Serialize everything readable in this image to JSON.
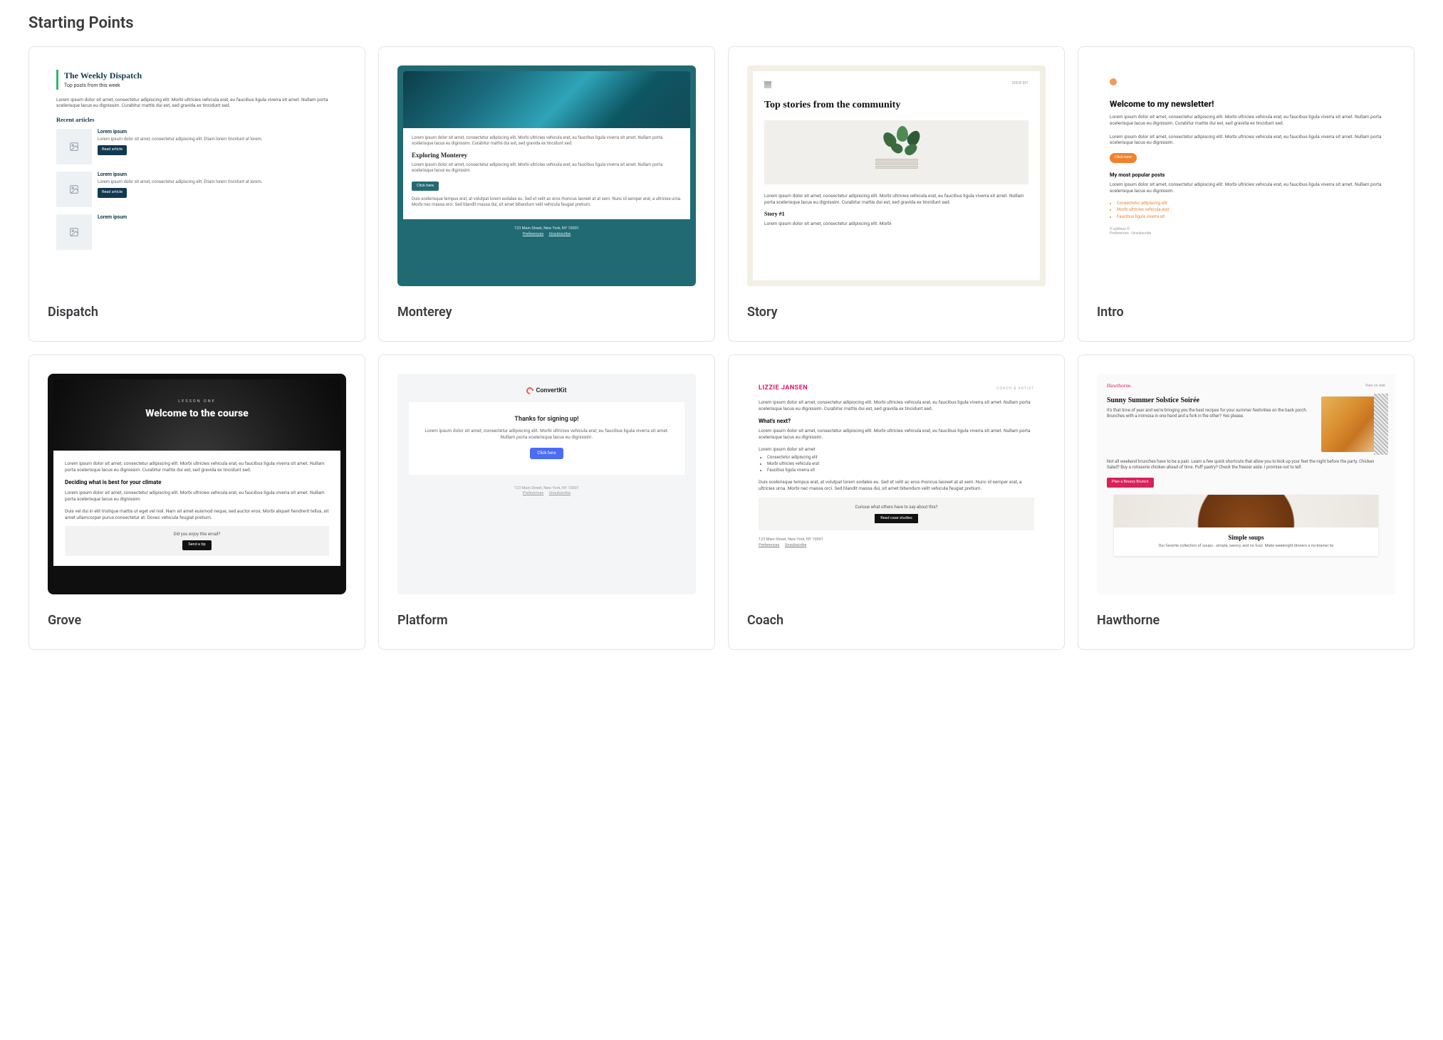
{
  "section_title": "Starting Points",
  "lorem_short": "Lorem ipsum dolor sit amet, consectetur adipiscing elit. Morbi ultricies vehicula erat, eu faucibus ligula viverra sit amet. Nullam porta scelerisque lacus eu dignissim. Curabitur mattis dui est, sed gravida ex tincidunt sed.",
  "lorem_mid": "Lorem ipsum dolor sit amet, consectetur adipiscing elit. Morbi ultricies vehicula erat, eu faucibus ligula viverra sit amet. Nullam porta scelerisque lacus eu dignissim.",
  "duis": "Duis scelerisque tempus erat, at volutpat lorem sodales eu. Sed et velit ac eros rhoncus laoreet at at sem. Nunc id semper erat, a ultricies urna. Morbi nec massa orci. Sed blandit massa dui, sit amet bibendum velit vehicula feugiat pretium.",
  "duis_short": "Duis vel dui in elit tristique mattis ut eget vel nisl. Nam sit amet euismod neque, sed auctor eros. Morbi aliquet hendrerit tellus, sit amet ullamcorper purus consectetur at. Donec vehicula feugiat pretium.",
  "templates": {
    "dispatch": {
      "label": "Dispatch",
      "title": "The Weekly Dispatch",
      "subtitle": "Top posts from this week",
      "recent_heading": "Recent articles",
      "item_title": "Lorem ipsum",
      "item_text": "Lorem ipsum dolor sit amet, consectetur adipiscing elit. Etiam lorem tincidunt at lorem.",
      "read_btn": "Read article"
    },
    "monterey": {
      "label": "Monterey",
      "heading": "Exploring Monterey",
      "btn": "Click here",
      "address": "123 Main Street, New York, NY 10001",
      "pref": "Preferences",
      "unsub": "Unsubscribe"
    },
    "story": {
      "label": "Story",
      "issue": "ISSUE 001",
      "headline": "Top stories from the community",
      "story_h": "Story #1",
      "story_p": "Lorem ipsum dolor sit amet, consectetur adipiscing elit. Morbi"
    },
    "intro": {
      "label": "Intro",
      "headline": "Welcome to my newsletter!",
      "btn": "Click here",
      "popular": "My most popular posts",
      "bullets": [
        "Consectetur adipiscing elit",
        "Morbi ultricies vehicula erat",
        "Faucibus ligula viverra sit"
      ],
      "addr": "© address ©",
      "pref": "Preferences",
      "unsub": "Unsubscribe"
    },
    "grove": {
      "label": "Grove",
      "eyebrow": "LESSON ONE",
      "headline": "Welcome to the course",
      "subhead": "Deciding what is best for your climate",
      "tip_q": "Did you enjoy this email?",
      "tip_btn": "Send a tip"
    },
    "platform": {
      "label": "Platform",
      "brand": "ConvertKit",
      "headline": "Thanks for signing up!",
      "btn": "Click here",
      "address": "123 Main Street, New York, NY 10001",
      "pref": "Preferences",
      "unsub": "Unsubscribe"
    },
    "coach": {
      "label": "Coach",
      "name": "LIZZIE JANSEN",
      "role": "COACH & ARTIST",
      "whats_next": "What's next?",
      "bullets": [
        "Consectetur adipiscing elit",
        "Morbi ultricies vehicula erat",
        "Faucibus ligula viverra sit"
      ],
      "cta_q": "Curious what others have to say about this?",
      "cta_btn": "Read case studies",
      "address": "123 Main Street, New York, NY 10001",
      "pref": "Preferences",
      "unsub": "Unsubscribe",
      "lead": "Lorem ipsum dolor sit amet"
    },
    "hawthorne": {
      "label": "Hawthorne",
      "brand": "Hawthorne.",
      "view_web": "View on web",
      "headline": "Sunny Summer Solstice Soirée",
      "intro": "It's that time of year and we're bringing you the best recipes for your summer festivities on the back porch. Brunches with a mimosa in one hand and a fork in the other? Yes please.",
      "mid_text": "Not all weekend brunches have to be a pain. Learn a few quick shortcuts that allow you to kick up your feet the night before the party. Chicken Salad? Buy a rotisserie chicken ahead of time. Puff pastry? Check the freezer aisle. I promise not to tell.",
      "btn": "Plan a Breezy Brunch",
      "soup_h": "Simple soups",
      "soup_p": "Our favorite collection of soups - simple, savory, and no fuss. Make weeknight dinners a no-brainer by"
    }
  }
}
